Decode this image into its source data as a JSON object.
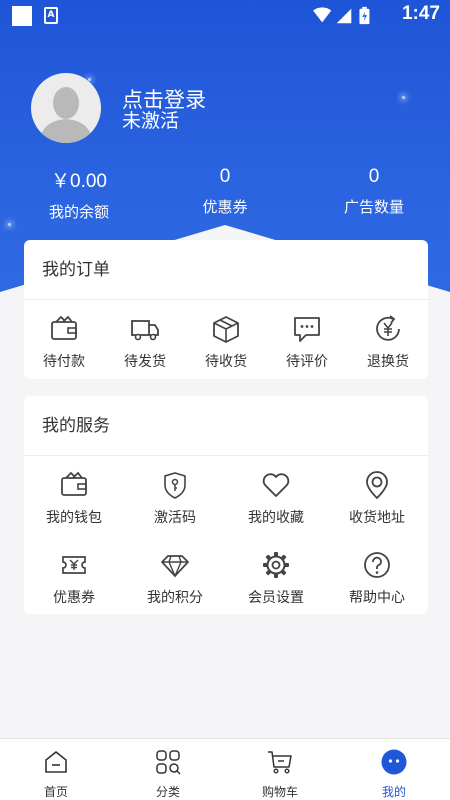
{
  "status_bar": {
    "time": "1:47",
    "a_badge": "A"
  },
  "profile": {
    "login_label": "点击登录",
    "status": "未激活"
  },
  "stats": [
    {
      "value": "￥0.00",
      "label": "我的余额"
    },
    {
      "value": "0",
      "label": "优惠券"
    },
    {
      "value": "0",
      "label": "广告数量"
    }
  ],
  "orders": {
    "title": "我的订单",
    "items": [
      {
        "label": "待付款",
        "icon": "wallet-icon"
      },
      {
        "label": "待发货",
        "icon": "truck-icon"
      },
      {
        "label": "待收货",
        "icon": "package-icon"
      },
      {
        "label": "待评价",
        "icon": "comment-icon"
      },
      {
        "label": "退换货",
        "icon": "refund-icon"
      }
    ]
  },
  "services": {
    "title": "我的服务",
    "items": [
      {
        "label": "我的钱包",
        "icon": "wallet-icon"
      },
      {
        "label": "激活码",
        "icon": "shield-key-icon"
      },
      {
        "label": "我的收藏",
        "icon": "heart-icon"
      },
      {
        "label": "收货地址",
        "icon": "location-icon"
      },
      {
        "label": "优惠券",
        "icon": "coupon-icon"
      },
      {
        "label": "我的积分",
        "icon": "diamond-icon"
      },
      {
        "label": "会员设置",
        "icon": "gear-icon"
      },
      {
        "label": "帮助中心",
        "icon": "help-icon"
      }
    ]
  },
  "tabbar": {
    "items": [
      {
        "label": "首页",
        "icon": "home-icon"
      },
      {
        "label": "分类",
        "icon": "category-icon"
      },
      {
        "label": "购物车",
        "icon": "cart-icon"
      },
      {
        "label": "我的",
        "icon": "profile-icon"
      }
    ],
    "active_index": 3
  },
  "colors": {
    "brand": "#1f57d9",
    "background": "#f5f5f7"
  }
}
